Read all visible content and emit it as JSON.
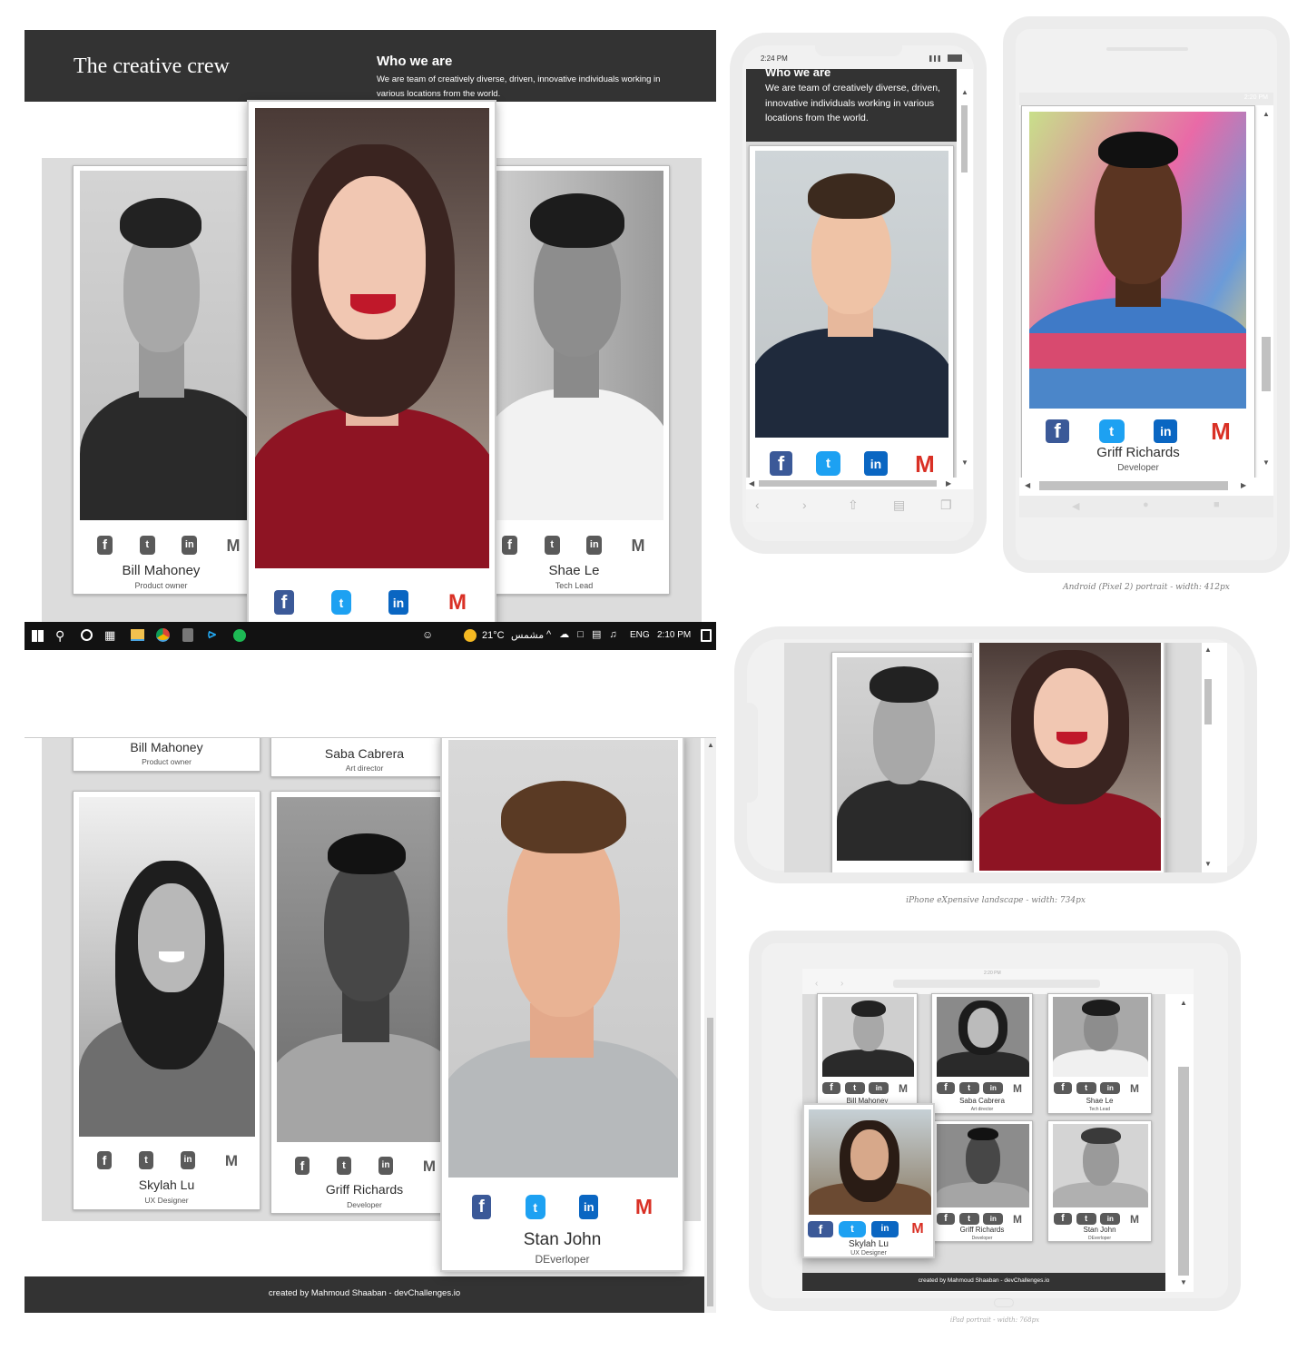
{
  "desktop": {
    "brand": "The creative crew",
    "who_title": "Who we are",
    "who_text": "We are team of creatively diverse, driven, innovative individuals working in various locations from the world.",
    "members": [
      {
        "name": "Bill Mahoney",
        "role": "Product owner"
      },
      {
        "name": "Saba Cabrera",
        "role": "Art director"
      },
      {
        "name": "Shae Le",
        "role": "Tech Lead"
      },
      {
        "name": "Skylah Lu",
        "role": "UX Designer"
      },
      {
        "name": "Griff Richards",
        "role": "Developer"
      },
      {
        "name": "Stan John",
        "role": "DEverloper"
      }
    ],
    "footer": "created by Mahmoud Shaaban - devChallenges.io"
  },
  "taskbar": {
    "weather": "21°C",
    "weather_text": "مشمس",
    "lang": "ENG",
    "time": "2:10 PM"
  },
  "iphone_portrait": {
    "time": "2:24 PM",
    "who_title": "Who we are",
    "who_text": "We are team of creatively diverse, driven, innovative individuals working in various locations from the world."
  },
  "android": {
    "status_time": "2:20 PM",
    "name": "Griff Richards",
    "role_partial": "Developer",
    "caption": "Android (Pixel 2) portrait - width: 412px"
  },
  "iphone_landscape": {
    "caption": "iPhone eXpensive landscape - width: 734px"
  },
  "ipad": {
    "status_time": "2:20 PM",
    "caption": "iPad portrait - width: 768px",
    "footer": "created by Mahmoud Shaaban - devChallenges.io"
  },
  "icons": [
    "facebook-icon",
    "twitter-icon",
    "linkedin-icon",
    "gmail-icon"
  ],
  "colors": {
    "dark_header": "#333333",
    "facebook": "#3b5998",
    "twitter": "#1da1f2",
    "linkedin": "#0a66c2",
    "gmail": "#d93025"
  }
}
